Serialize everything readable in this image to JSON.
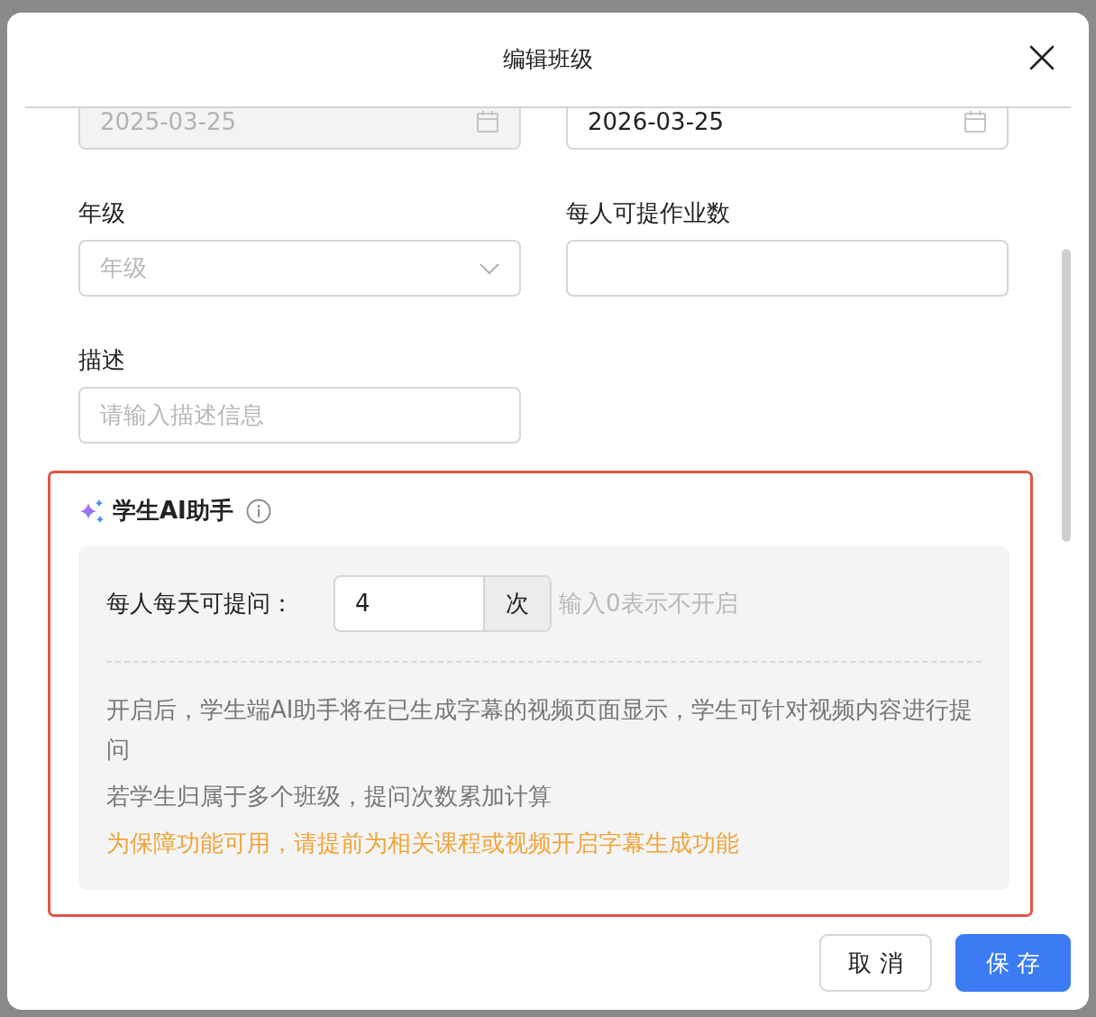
{
  "dialog": {
    "title": "编辑班级"
  },
  "date_fields": [
    {
      "value": "2025-03-25",
      "disabled": true
    },
    {
      "value": "2026-03-25",
      "disabled": false
    }
  ],
  "fields": [
    {
      "label": "年级",
      "kind": "select",
      "placeholder": "年级"
    },
    {
      "label": "每人可提作业数",
      "kind": "input"
    },
    {
      "label": "描述",
      "kind": "input",
      "placeholder": "请输入描述信息"
    }
  ],
  "ai_assistant": {
    "title": "学生AI助手",
    "question_label": "每人每天可提问：",
    "value": "4",
    "unit": "次",
    "hint": "输入0表示不开启",
    "notes": [
      {
        "kind": "info",
        "text": "开启后，学生端AI助手将在已生成字幕的视频页面显示，学生可针对视频内容进行提问"
      },
      {
        "kind": "info",
        "text": "若学生归属于多个班级，提问次数累加计算"
      },
      {
        "kind": "warning",
        "text": "为保障功能可用，请提前为相关课程或视频开启字幕生成功能"
      }
    ]
  },
  "buttons": [
    {
      "label": "取 消",
      "kind": "secondary"
    },
    {
      "label": "保 存",
      "kind": "primary"
    }
  ]
}
